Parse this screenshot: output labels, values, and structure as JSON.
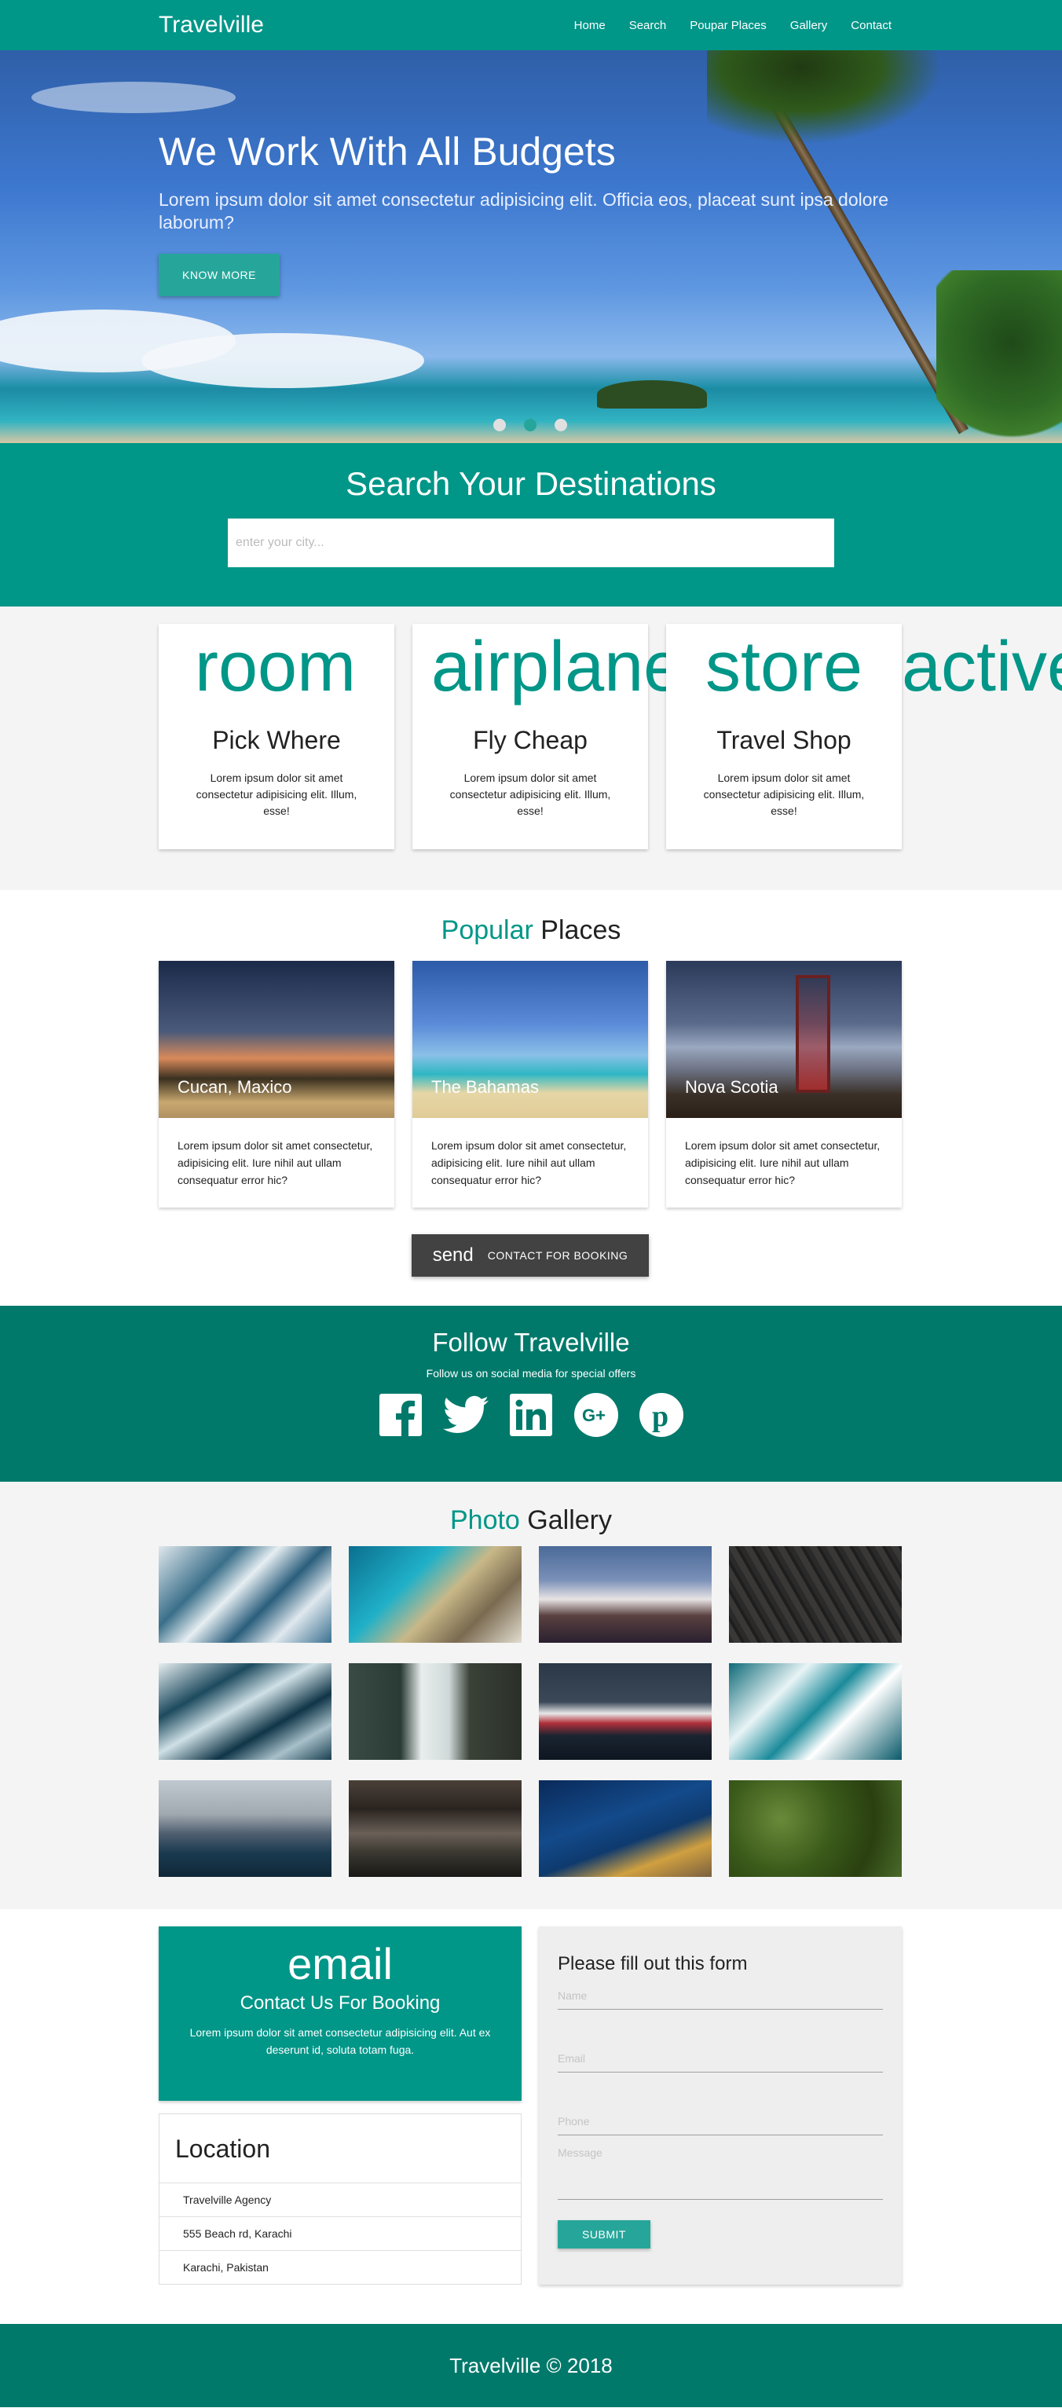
{
  "nav": {
    "brand": "Travelville",
    "items": [
      "Home",
      "Search",
      "Poupar Places",
      "Gallery",
      "Contact"
    ]
  },
  "hero": {
    "title": "We Work With All Budgets",
    "subtitle": "Lorem ipsum dolor sit amet consectetur adipisicing elit. Officia eos, placeat sunt ipsa dolore laborum?",
    "button": "KNOW MORE",
    "slides": 3,
    "active_slide": 2
  },
  "search": {
    "title": "Search Your Destinations",
    "placeholder": "enter your city..."
  },
  "features": [
    {
      "icon": "room",
      "title": "Pick Where",
      "text": "Lorem ipsum dolor sit amet consectetur adipisicing elit. Illum, esse!"
    },
    {
      "icon": "airplane",
      "title": "Fly Cheap",
      "text": "Lorem ipsum dolor sit amet consectetur adipisicing elit. Illum, esse!"
    },
    {
      "icon": "store",
      "title": "Travel Shop",
      "text": "Lorem ipsum dolor sit amet consectetur adipisicing elit. Illum, esse!"
    }
  ],
  "stray_icon": "active",
  "popular": {
    "title_accent": "Popular",
    "title_rest": "Places",
    "places": [
      {
        "name": "Cucan, Maxico",
        "text": "Lorem ipsum dolor sit amet consectetur, adipisicing elit. Iure nihil aut ullam consequatur error hic?"
      },
      {
        "name": "The Bahamas",
        "text": "Lorem ipsum dolor sit amet consectetur, adipisicing elit. Iure nihil aut ullam consequatur error hic?"
      },
      {
        "name": "Nova Scotia",
        "text": "Lorem ipsum dolor sit amet consectetur, adipisicing elit. Iure nihil aut ullam consequatur error hic?"
      }
    ],
    "button_icon": "send",
    "button_label": "CONTACT FOR BOOKING"
  },
  "follow": {
    "title": "Follow Travelville",
    "subtitle": "Follow us on social media for special offers",
    "icons": [
      "facebook-icon",
      "twitter-icon",
      "linkedin-icon",
      "google-plus-icon",
      "pinterest-icon"
    ]
  },
  "gallery": {
    "title_accent": "Photo",
    "title_rest": "Gallery"
  },
  "contact": {
    "icon": "email",
    "title": "Contact Us For Booking",
    "text": "Lorem ipsum dolor sit amet consectetur adipisicing elit. Aut ex deserunt id, soluta totam fuga.",
    "location_title": "Location",
    "location_items": [
      "Travelville Agency",
      "555 Beach rd, Karachi",
      "Karachi, Pakistan"
    ],
    "form_title": "Please fill out this form",
    "name_placeholder": "Name",
    "email_placeholder": "Email",
    "phone_placeholder": "Phone",
    "message_placeholder": "Message",
    "submit": "SUBMIT"
  },
  "footer": {
    "text": "Travelville © 2018"
  },
  "colors": {
    "primary": "#009688",
    "primary_dark": "#00796b",
    "button": "#26a69a",
    "dark_button": "#424242"
  }
}
